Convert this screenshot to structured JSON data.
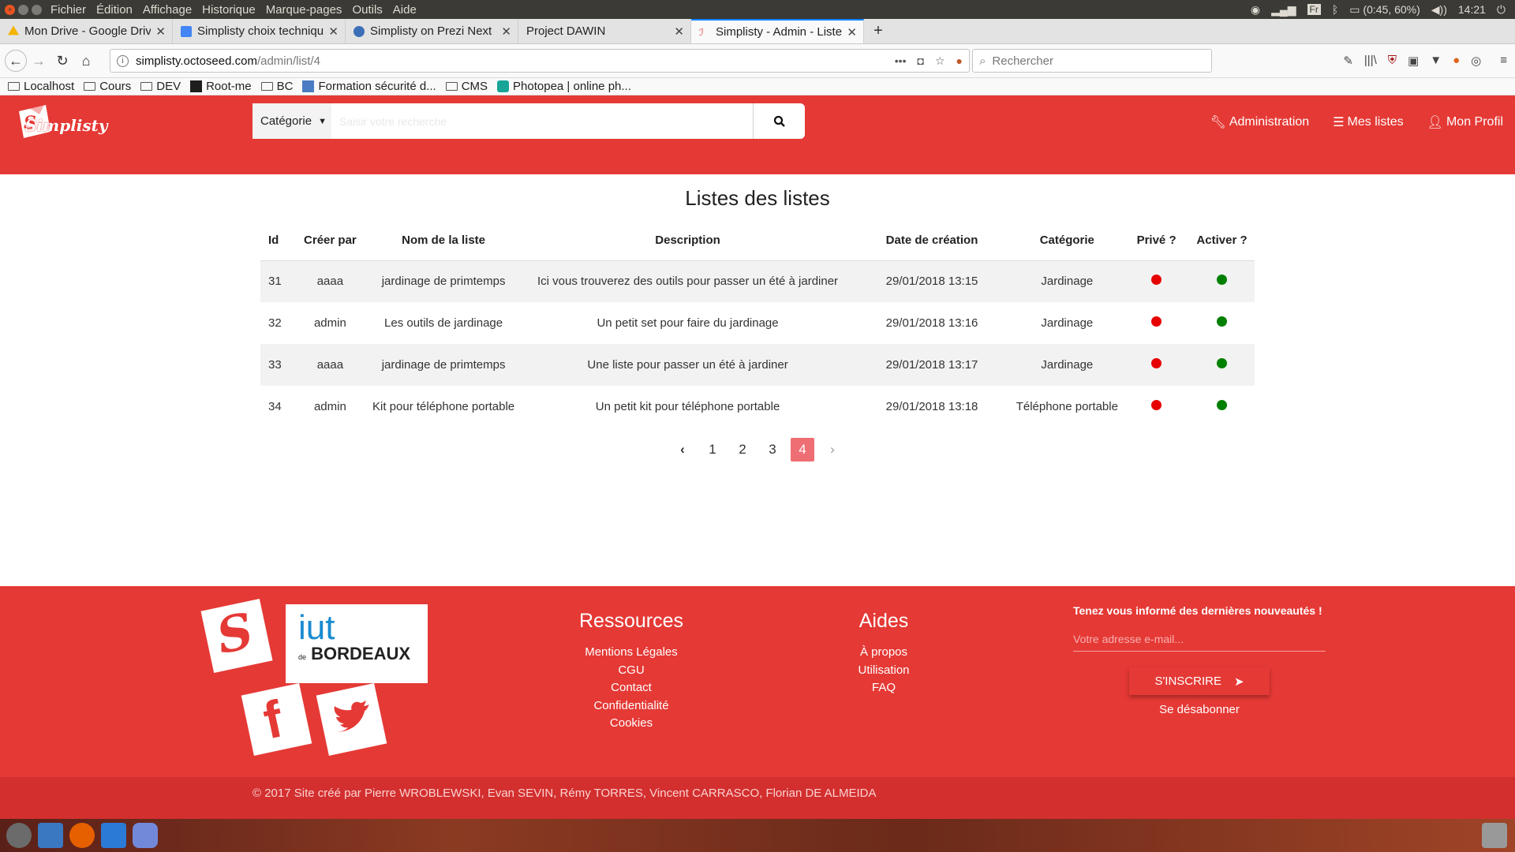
{
  "os": {
    "menu": [
      "Fichier",
      "Édition",
      "Affichage",
      "Historique",
      "Marque-pages",
      "Outils",
      "Aide"
    ],
    "lang": "Fr",
    "battery": "(0:45, 60%)",
    "time": "14:21"
  },
  "tabs": [
    {
      "label": "Mon Drive - Google Driv",
      "color": "#f4b400"
    },
    {
      "label": "Simplisty choix techniqu",
      "color": "#4285f4"
    },
    {
      "label": "Simplisty on Prezi Next",
      "color": "#3b6fb6"
    },
    {
      "label": "Project DAWIN",
      "color": "#e3e3e3"
    },
    {
      "label": "Simplisty - Admin - Listes",
      "color": "#e53935"
    }
  ],
  "url": {
    "domain": "simplisty.octoseed.com",
    "path": "/admin/list/4"
  },
  "search_placeholder": "Rechercher",
  "bookmarks": [
    "Localhost",
    "Cours",
    "DEV",
    "Root-me",
    "BC",
    "Formation sécurité d...",
    "CMS",
    "Photopea | online ph..."
  ],
  "site": {
    "logo_text": "Simplisty",
    "category_label": "Catégorie",
    "search_placeholder": "Saisir votre recherche",
    "nav": [
      "Administration",
      "Mes listes",
      "Mon Profil"
    ]
  },
  "page_title": "Listes des listes",
  "table": {
    "headers": [
      "Id",
      "Créer par",
      "Nom de la liste",
      "Description",
      "Date de création",
      "Catégorie",
      "Privé ?",
      "Activer ?"
    ],
    "rows": [
      {
        "id": "31",
        "by": "aaaa",
        "name": "jardinage de primtemps",
        "desc": "Ici vous trouverez des outils pour passer un été à jardiner",
        "date": "29/01/2018 13:15",
        "cat": "Jardinage",
        "prive": false,
        "active": true
      },
      {
        "id": "32",
        "by": "admin",
        "name": "Les outils de jardinage",
        "desc": "Un petit set pour faire du jardinage",
        "date": "29/01/2018 13:16",
        "cat": "Jardinage",
        "prive": false,
        "active": true
      },
      {
        "id": "33",
        "by": "aaaa",
        "name": "jardinage de primtemps",
        "desc": "Une liste pour passer un été à jardiner",
        "date": "29/01/2018 13:17",
        "cat": "Jardinage",
        "prive": false,
        "active": true
      },
      {
        "id": "34",
        "by": "admin",
        "name": "Kit pour téléphone portable",
        "desc": "Un petit kit pour téléphone portable",
        "date": "29/01/2018 13:18",
        "cat": "Téléphone portable",
        "prive": false,
        "active": true
      }
    ]
  },
  "pagination": {
    "pages": [
      "1",
      "2",
      "3",
      "4"
    ],
    "current": "4"
  },
  "colors": {
    "brand_red": "#e53935",
    "dot_red": "#e60000",
    "dot_green": "#008000",
    "page_active": "#ee6e73"
  },
  "footer": {
    "iut_line1": "iut",
    "iut_de": "de",
    "iut_line2": "BORDEAUX",
    "ressources_title": "Ressources",
    "ressources": [
      "Mentions Légales",
      "CGU",
      "Contact",
      "Confidentialité",
      "Cookies"
    ],
    "aides_title": "Aides",
    "aides": [
      "À propos",
      "Utilisation",
      "FAQ"
    ],
    "newsletter_title": "Tenez vous informé des dernières nouveautés !",
    "email_placeholder": "Votre adresse e-mail...",
    "subscribe": "S'INSCRIRE",
    "unsubscribe": "Se désabonner",
    "copyright": "© 2017 Site créé par Pierre WROBLEWSKI, Evan SEVIN, Rémy TORRES, Vincent CARRASCO, Florian DE ALMEIDA"
  }
}
